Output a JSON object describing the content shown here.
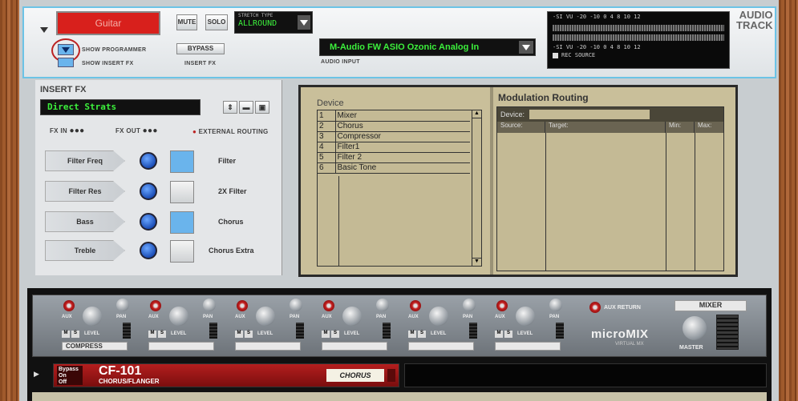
{
  "header": {
    "name": "Guitar",
    "mute": "MUTE",
    "solo": "SOLO",
    "stretch_label": "STRETCH TYPE",
    "stretch_value": "ALLROUND",
    "show_programmer": "SHOW PROGRAMMER",
    "show_insert_fx": "SHOW INSERT FX",
    "bypass": "BYPASS",
    "insert_fx_label": "INSERT FX",
    "audio_input_value": "M-Audio FW ASIO Ozonic Analog In",
    "audio_input_label": "AUDIO INPUT",
    "meter_scale": "-SI  VU  -20  -10    0   4  8 10 12",
    "rec_source": "REC SOURCE",
    "device_title_1": "AUDIO",
    "device_title_2": "TRACK"
  },
  "insert_fx": {
    "title": "INSERT FX",
    "patch": "Direct Strats",
    "fx_in": "FX IN",
    "fx_out": "FX OUT",
    "external_routing": "EXTERNAL ROUTING",
    "params": [
      {
        "knob": "Filter Freq",
        "button": "Filter",
        "on": true
      },
      {
        "knob": "Filter Res",
        "button": "2X Filter",
        "on": false
      },
      {
        "knob": "Bass",
        "button": "Chorus",
        "on": true
      },
      {
        "knob": "Treble",
        "button": "Chorus Extra",
        "on": false
      }
    ]
  },
  "programmer": {
    "device_label": "Device",
    "devices": [
      {
        "num": "1",
        "name": "Mixer"
      },
      {
        "num": "2",
        "name": "Chorus"
      },
      {
        "num": "3",
        "name": "Compressor"
      },
      {
        "num": "4",
        "name": "Filter1"
      },
      {
        "num": "5",
        "name": "Filter 2"
      },
      {
        "num": "6",
        "name": "Basic Tone"
      }
    ],
    "mod_title": "Modulation Routing",
    "mod_device": "Device:",
    "col_source": "Source:",
    "col_target": "Target:",
    "col_min": "Min:",
    "col_max": "Max:"
  },
  "mixer": {
    "aux": "AUX",
    "pan": "PAN",
    "level": "LEVEL",
    "strip1_label": "COMPRESS",
    "aux_return": "AUX RETURN",
    "mixer_label": "MIXER",
    "brand": "microMIX",
    "brand_sub": "VIRTUAL MX",
    "master": "MASTER"
  },
  "cf101": {
    "bypass": "Bypass",
    "on": "On",
    "off": "Off",
    "title": "CF-101",
    "subtitle": "CHORUS/FLANGER",
    "patch": "CHORUS"
  },
  "colors": {
    "accent": "#6cc3e6",
    "name_red": "#d8201c",
    "lcd_green": "#3cf03c",
    "programmer_bg": "#c9bf9a"
  }
}
